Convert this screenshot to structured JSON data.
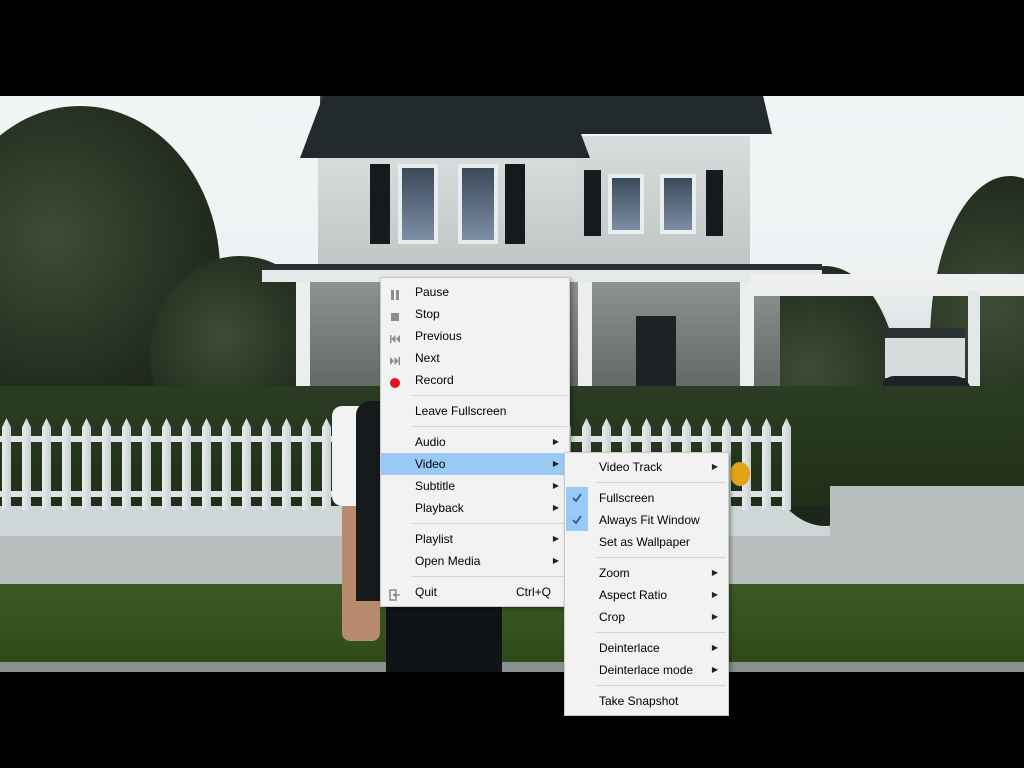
{
  "main_menu": {
    "items": [
      {
        "label": "Pause",
        "icon": "pause-icon"
      },
      {
        "label": "Stop",
        "icon": "stop-icon"
      },
      {
        "label": "Previous",
        "icon": "previous-icon"
      },
      {
        "label": "Next",
        "icon": "next-icon"
      },
      {
        "label": "Record",
        "icon": "record-icon"
      },
      {
        "label": "Leave Fullscreen"
      },
      {
        "label": "Audio",
        "submenu": true
      },
      {
        "label": "Video",
        "submenu": true,
        "active": true
      },
      {
        "label": "Subtitle",
        "submenu": true
      },
      {
        "label": "Playback",
        "submenu": true
      },
      {
        "label": "Playlist",
        "submenu": true
      },
      {
        "label": "Open Media",
        "submenu": true
      },
      {
        "label": "Quit",
        "shortcut": "Ctrl+Q",
        "icon": "quit-icon"
      }
    ]
  },
  "video_submenu": {
    "items": [
      {
        "label": "Video Track",
        "submenu": true
      },
      {
        "label": "Fullscreen",
        "checked": true
      },
      {
        "label": "Always Fit Window",
        "checked": true
      },
      {
        "label": "Set as Wallpaper"
      },
      {
        "label": "Zoom",
        "submenu": true
      },
      {
        "label": "Aspect Ratio",
        "submenu": true
      },
      {
        "label": "Crop",
        "submenu": true
      },
      {
        "label": "Deinterlace",
        "submenu": true
      },
      {
        "label": "Deinterlace mode",
        "submenu": true
      },
      {
        "label": "Take Snapshot"
      }
    ]
  },
  "colors": {
    "menu_bg": "#f2f2f2",
    "highlight": "#99c9f5",
    "record_red": "#e0141b",
    "letterbox": "#000000"
  }
}
